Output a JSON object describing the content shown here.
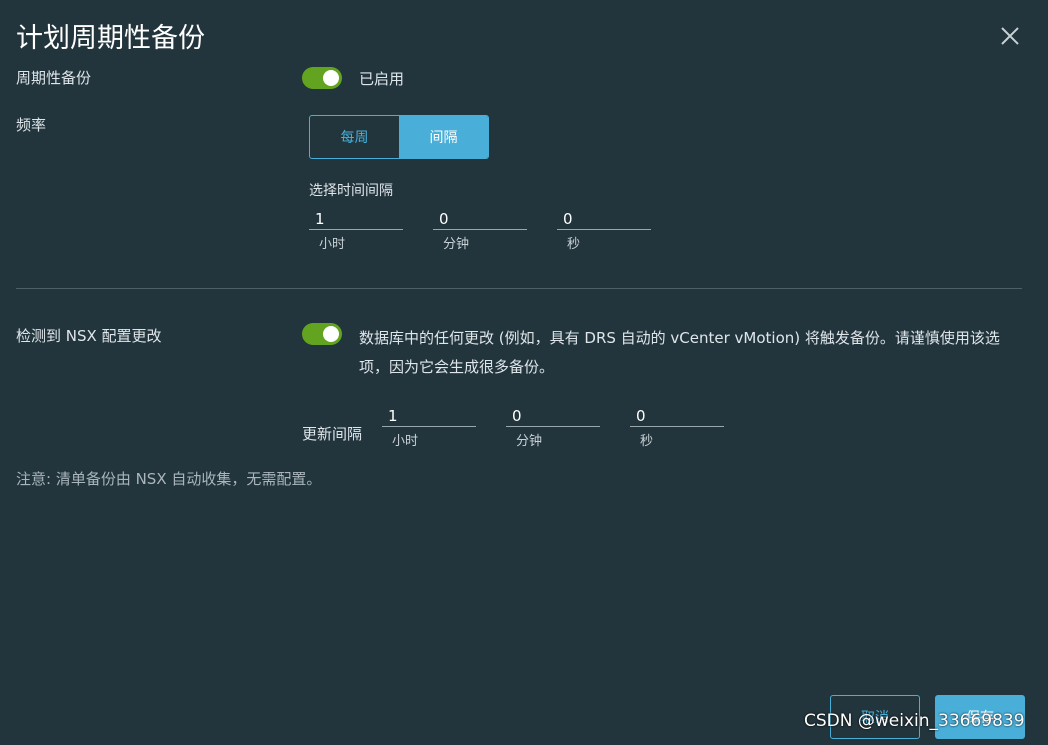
{
  "dialog": {
    "title": "计划周期性备份"
  },
  "periodic_backup": {
    "label": "周期性备份",
    "status": "已启用"
  },
  "frequency": {
    "label": "频率",
    "options": [
      "每周",
      "间隔"
    ],
    "selected": "间隔",
    "interval_label": "选择时间间隔",
    "hours": "1",
    "minutes": "0",
    "seconds": "0",
    "hours_unit": "小时",
    "minutes_unit": "分钟",
    "seconds_unit": "秒"
  },
  "detect_changes": {
    "label": "检测到 NSX 配置更改",
    "description": "数据库中的任何更改 (例如，具有 DRS 自动的 vCenter vMotion) 将触发备份。请谨慎使用该选项，因为它会生成很多备份。",
    "update_interval_label": "更新间隔",
    "hours": "1",
    "minutes": "0",
    "seconds": "0",
    "hours_unit": "小时",
    "minutes_unit": "分钟",
    "seconds_unit": "秒"
  },
  "note": "注意: 清单备份由 NSX 自动收集，无需配置。",
  "buttons": {
    "cancel": "取消",
    "save": "保存"
  },
  "watermark": "CSDN @weixin_33669839",
  "colors": {
    "background": "#22343c",
    "accent": "#49afd9",
    "toggle_on": "#62a420"
  },
  "icons": {
    "close": "close-icon"
  }
}
